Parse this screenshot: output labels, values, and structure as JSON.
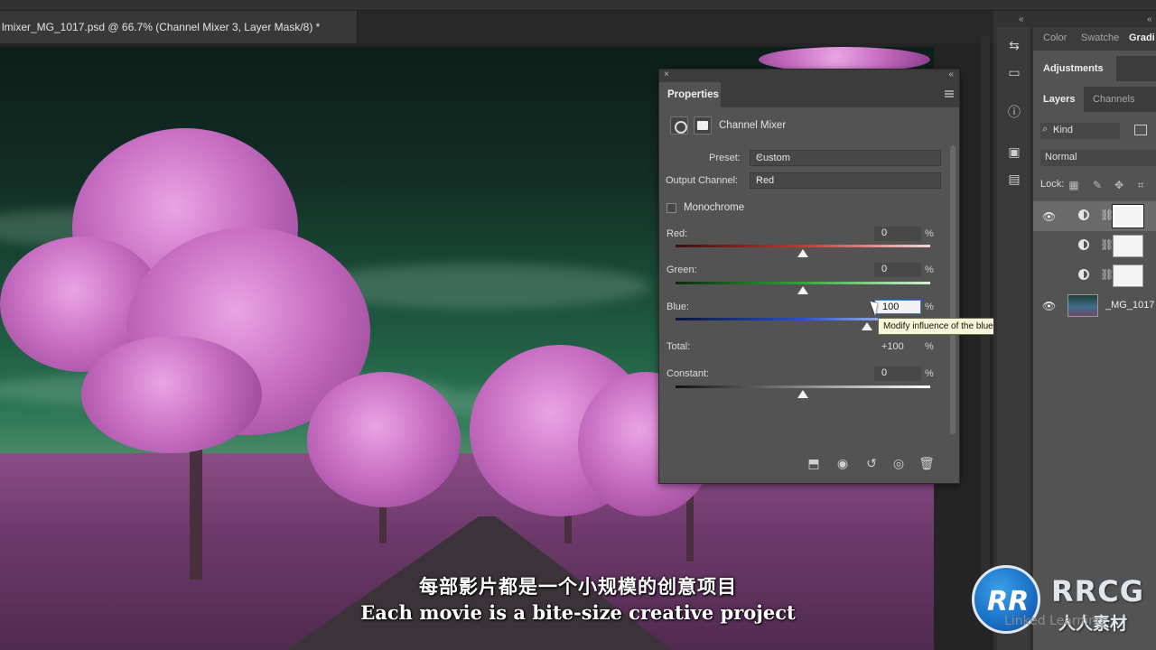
{
  "document": {
    "tab_title": "lmixer_MG_1017.psd @ 66.7% (Channel Mixer 3, Layer Mask/8) *"
  },
  "properties_panel": {
    "tab_label": "Properties",
    "adjustment_name": "Channel Mixer",
    "preset_label": "Preset:",
    "preset_value": "Custom",
    "output_channel_label": "Output Channel:",
    "output_channel_value": "Red",
    "monochrome_label": "Monochrome",
    "monochrome_checked": false,
    "sliders": [
      {
        "label": "Red:",
        "value": "0",
        "unit": "%",
        "level": 0
      },
      {
        "label": "Green:",
        "value": "0",
        "unit": "%",
        "level": 0
      },
      {
        "label": "Blue:",
        "value": "100",
        "unit": "%",
        "level": 100,
        "focused": true
      }
    ],
    "total_label": "Total:",
    "total_value": "+100",
    "total_unit": "%",
    "constant": {
      "label": "Constant:",
      "value": "0",
      "unit": "%",
      "level": 0
    },
    "tooltip": "Modify influence of the blue channel within the overall mix",
    "footer_icons": [
      "clip-to-layer-icon",
      "view-previous-icon",
      "reset-icon",
      "visibility-icon",
      "delete-icon"
    ]
  },
  "right_panels": {
    "top_tabs": [
      "Color",
      "Swatche",
      "Gradi"
    ],
    "adjustments_tab": "Adjustments",
    "layers_tab": "Layers",
    "channels_tab": "Channels",
    "kind_filter": "Kind",
    "blend_mode": "Normal",
    "lock_label": "Lock:",
    "layers": [
      {
        "type": "adjustment",
        "visible": true,
        "selected": true
      },
      {
        "type": "adjustment",
        "visible": false,
        "selected": false
      },
      {
        "type": "adjustment",
        "visible": false,
        "selected": false
      },
      {
        "type": "image",
        "visible": true,
        "name": "_MG_1017"
      }
    ]
  },
  "subtitles": {
    "chinese": "每部影片都是一个小规模的创意项目",
    "english": "Each movie is a bite-size creative project"
  },
  "watermark": {
    "logo_letters": "RR",
    "brand": "RRCG",
    "sub": "人人素材",
    "linkedin": "Linked Learning"
  },
  "colors": {
    "red_track": "#d03030",
    "green_track": "#2fa83a",
    "blue_track": "#2d4fd0",
    "tooltip_bg": "#f6f6d9",
    "panel_bg": "#535353"
  }
}
